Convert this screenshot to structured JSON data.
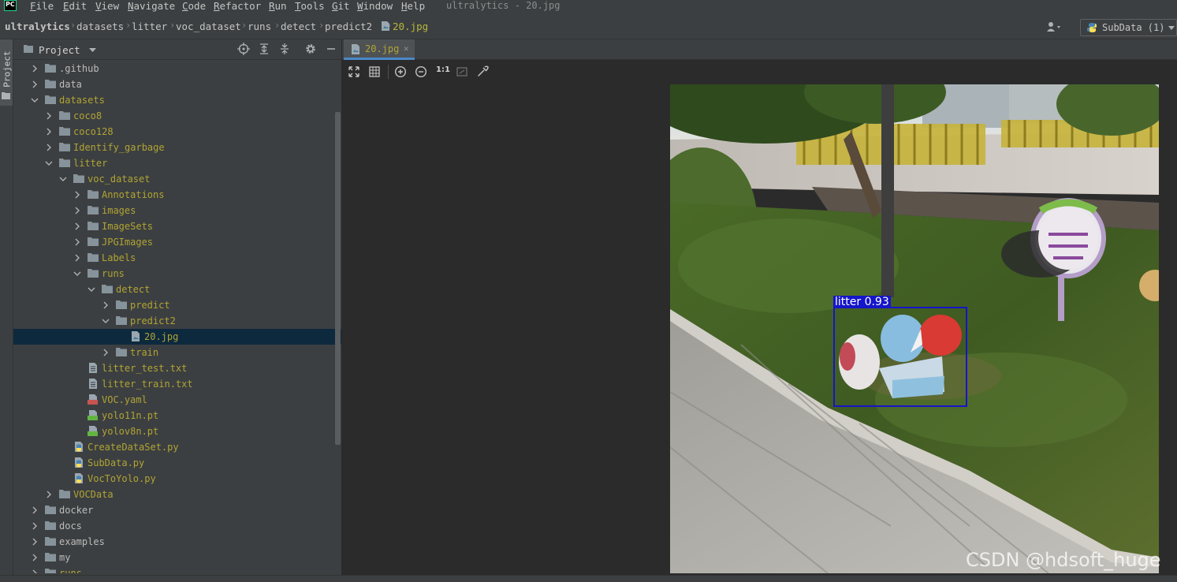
{
  "menu": {
    "logo": "PC",
    "items": [
      {
        "label": "File",
        "u": "F",
        "rest": "ile"
      },
      {
        "label": "Edit",
        "u": "E",
        "rest": "dit"
      },
      {
        "label": "View",
        "u": "V",
        "rest": "iew"
      },
      {
        "label": "Navigate",
        "u": "N",
        "rest": "avigate"
      },
      {
        "label": "Code",
        "u": "C",
        "rest": "ode"
      },
      {
        "label": "Refactor",
        "u": "R",
        "rest": "efactor"
      },
      {
        "label": "Run",
        "u": "R",
        "rest": "un"
      },
      {
        "label": "Tools",
        "u": "T",
        "rest": "ools"
      },
      {
        "label": "Git",
        "u": "G",
        "rest": "it"
      },
      {
        "label": "Window",
        "u": "W",
        "rest": "indow"
      },
      {
        "label": "Help",
        "u": "H",
        "rest": "elp"
      }
    ],
    "window_title": "ultralytics - 20.jpg"
  },
  "breadcrumb": [
    "ultralytics",
    "datasets",
    "litter",
    "voc_dataset",
    "runs",
    "detect",
    "predict2",
    "20.jpg"
  ],
  "run_config": "SubData (1)",
  "side_stripe": {
    "project_tab": "Project"
  },
  "project_panel": {
    "title": "Project",
    "tree": [
      {
        "label": ".github",
        "kind": "folder",
        "indent": 0,
        "expanded": false,
        "color": "normal"
      },
      {
        "label": "data",
        "kind": "folder",
        "indent": 0,
        "expanded": false,
        "color": "normal"
      },
      {
        "label": "datasets",
        "kind": "folder",
        "indent": 0,
        "expanded": true,
        "color": "excluded"
      },
      {
        "label": "coco8",
        "kind": "folder",
        "indent": 1,
        "expanded": false,
        "color": "excluded"
      },
      {
        "label": "coco128",
        "kind": "folder",
        "indent": 1,
        "expanded": false,
        "color": "excluded"
      },
      {
        "label": "Identify_garbage",
        "kind": "folder",
        "indent": 1,
        "expanded": false,
        "color": "excluded"
      },
      {
        "label": "litter",
        "kind": "folder",
        "indent": 1,
        "expanded": true,
        "color": "excluded"
      },
      {
        "label": "voc_dataset",
        "kind": "folder",
        "indent": 2,
        "expanded": true,
        "color": "excluded"
      },
      {
        "label": "Annotations",
        "kind": "folder",
        "indent": 3,
        "expanded": false,
        "color": "excluded"
      },
      {
        "label": "images",
        "kind": "folder",
        "indent": 3,
        "expanded": false,
        "color": "excluded"
      },
      {
        "label": "ImageSets",
        "kind": "folder",
        "indent": 3,
        "expanded": false,
        "color": "excluded"
      },
      {
        "label": "JPGImages",
        "kind": "folder",
        "indent": 3,
        "expanded": false,
        "color": "excluded"
      },
      {
        "label": "Labels",
        "kind": "folder",
        "indent": 3,
        "expanded": false,
        "color": "excluded"
      },
      {
        "label": "runs",
        "kind": "folder",
        "indent": 3,
        "expanded": true,
        "color": "excluded"
      },
      {
        "label": "detect",
        "kind": "folder",
        "indent": 4,
        "expanded": true,
        "color": "excluded"
      },
      {
        "label": "predict",
        "kind": "folder",
        "indent": 5,
        "expanded": false,
        "color": "excluded"
      },
      {
        "label": "predict2",
        "kind": "folder",
        "indent": 5,
        "expanded": true,
        "color": "excluded"
      },
      {
        "label": "20.jpg",
        "kind": "image",
        "indent": 6,
        "expanded": null,
        "color": "excluded",
        "selected": true
      },
      {
        "label": "train",
        "kind": "folder",
        "indent": 5,
        "expanded": false,
        "color": "excluded"
      },
      {
        "label": "litter_test.txt",
        "kind": "text",
        "indent": 3,
        "expanded": null,
        "color": "excluded"
      },
      {
        "label": "litter_train.txt",
        "kind": "text",
        "indent": 3,
        "expanded": null,
        "color": "excluded"
      },
      {
        "label": "VOC.yaml",
        "kind": "yaml",
        "indent": 3,
        "expanded": null,
        "color": "excluded"
      },
      {
        "label": "yolo11n.pt",
        "kind": "pt",
        "indent": 3,
        "expanded": null,
        "color": "excluded"
      },
      {
        "label": "yolov8n.pt",
        "kind": "pt",
        "indent": 3,
        "expanded": null,
        "color": "excluded"
      },
      {
        "label": "CreateDataSet.py",
        "kind": "python",
        "indent": 2,
        "expanded": null,
        "color": "excluded"
      },
      {
        "label": "SubData.py",
        "kind": "python",
        "indent": 2,
        "expanded": null,
        "color": "excluded"
      },
      {
        "label": "VocToYolo.py",
        "kind": "python",
        "indent": 2,
        "expanded": null,
        "color": "excluded"
      },
      {
        "label": "VOCData",
        "kind": "folder",
        "indent": 1,
        "expanded": false,
        "color": "excluded"
      },
      {
        "label": "docker",
        "kind": "folder",
        "indent": 0,
        "expanded": false,
        "color": "normal"
      },
      {
        "label": "docs",
        "kind": "folder",
        "indent": 0,
        "expanded": false,
        "color": "normal"
      },
      {
        "label": "examples",
        "kind": "folder",
        "indent": 0,
        "expanded": false,
        "color": "normal"
      },
      {
        "label": "my",
        "kind": "folder",
        "indent": 0,
        "expanded": false,
        "color": "normal"
      },
      {
        "label": "runs",
        "kind": "folder",
        "indent": 0,
        "expanded": false,
        "color": "excluded"
      }
    ]
  },
  "editor": {
    "tab_label": "20.jpg",
    "toolbar": {
      "actual_size_label": "1:1"
    }
  },
  "image": {
    "detection_label": "litter 0.93",
    "watermark": "CSDN @hdsoft_huge"
  },
  "colors": {
    "accent_tab": "#4a88c7",
    "excluded_folder_text": "#b0a434",
    "selection": "#0d293e",
    "detection_box": "#1515c9"
  }
}
